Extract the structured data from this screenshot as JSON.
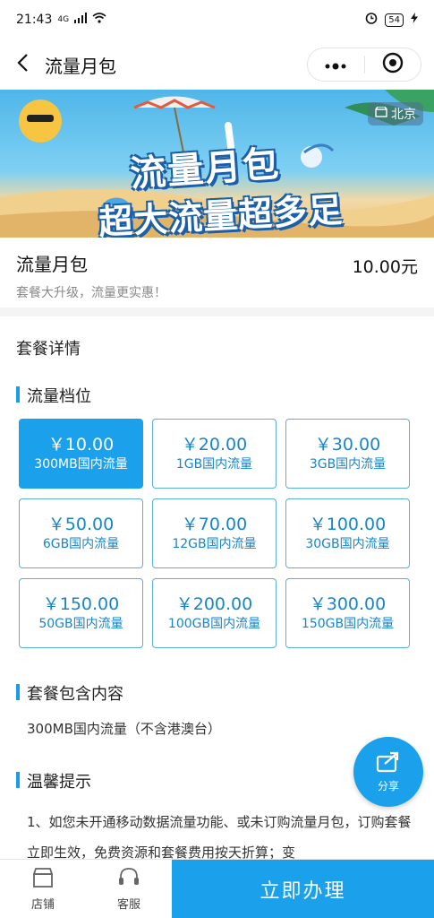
{
  "status_bar": {
    "time": "21:43",
    "network": "4G",
    "battery": "54"
  },
  "nav": {
    "title": "流量月包"
  },
  "banner": {
    "region": "北京",
    "title": "流量月包",
    "subtitle": "超大流量超多足"
  },
  "product": {
    "name": "流量月包",
    "price": "10.00元",
    "description": "套餐大升级，流量更实惠！"
  },
  "sections": {
    "details_title": "套餐详情",
    "tiers_title": "流量档位",
    "contents_title": "套餐包含内容",
    "tips_title": "温馨提示"
  },
  "tiers": [
    {
      "price": "￥10.00",
      "data": "300MB国内流量",
      "selected": true
    },
    {
      "price": "￥20.00",
      "data": "1GB国内流量",
      "selected": false
    },
    {
      "price": "￥30.00",
      "data": "3GB国内流量",
      "selected": false
    },
    {
      "price": "￥50.00",
      "data": "6GB国内流量",
      "selected": false
    },
    {
      "price": "￥70.00",
      "data": "12GB国内流量",
      "selected": false
    },
    {
      "price": "￥100.00",
      "data": "30GB国内流量",
      "selected": false
    },
    {
      "price": "￥150.00",
      "data": "50GB国内流量",
      "selected": false
    },
    {
      "price": "￥200.00",
      "data": "100GB国内流量",
      "selected": false
    },
    {
      "price": "￥300.00",
      "data": "150GB国内流量",
      "selected": false
    }
  ],
  "contents_text": "300MB国内流量（不含港澳台）",
  "tips_text": "1、如您未开通移动数据流量功能、或未订购流量月包，订购套餐立即生效，免费资源和套餐费用按天折算；变",
  "share": {
    "label": "分享"
  },
  "bottom_bar": {
    "store_label": "店铺",
    "service_label": "客服",
    "cta_label": "立即办理"
  },
  "colors": {
    "accent": "#1ba0ec",
    "tier_border": "#5aaed8",
    "tier_text": "#1786c8"
  }
}
